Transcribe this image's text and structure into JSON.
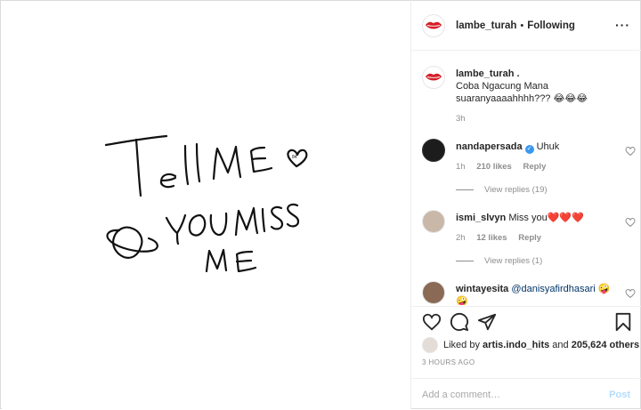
{
  "header": {
    "username": "lambe_turah",
    "separator": "•",
    "follow_state": "Following",
    "more_icon": "more-horizontal-icon"
  },
  "caption": {
    "username": "lambe_turah .",
    "text": "Coba Ngacung Mana suaranyaaaahhhh??? 😂😂😂",
    "time": "3h"
  },
  "comments": [
    {
      "username": "nandapersada",
      "verified": true,
      "text": "Uhuk",
      "time": "1h",
      "likes": "210 likes",
      "reply": "Reply",
      "view_replies": "View replies (19)"
    },
    {
      "username": "ismi_slvyn",
      "verified": false,
      "text": "Miss you❤️❤️❤️",
      "time": "2h",
      "likes": "12 likes",
      "reply": "Reply",
      "view_replies": "View replies (1)"
    },
    {
      "username": "wintayesita",
      "mention": "@danisyafirdhasari",
      "text": "🤪 🤪"
    }
  ],
  "actions": {
    "liked_prefix": "Liked by",
    "liked_user": "artis.indo_hits",
    "liked_and": "and",
    "liked_count": "205,624 others",
    "timestamp": "3 HOURS AGO"
  },
  "add_comment": {
    "placeholder": "Add a comment…",
    "post_label": "Post"
  },
  "colors": {
    "verified": "#3897f0",
    "post_disabled": "#b3dbff",
    "mention": "#003569",
    "logo_lips": "#d4202a"
  }
}
